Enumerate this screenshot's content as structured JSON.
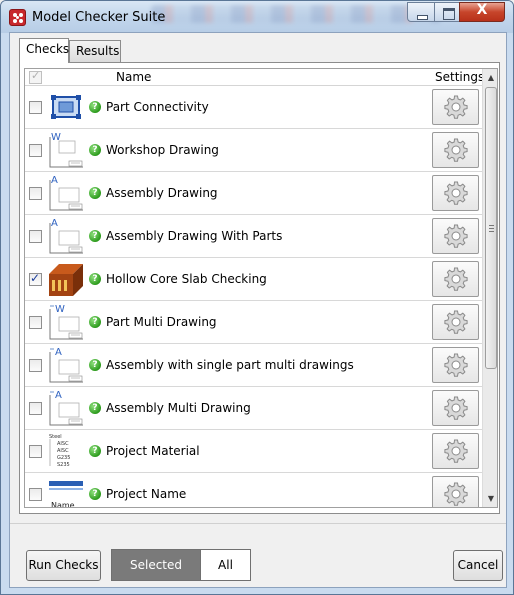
{
  "window": {
    "title": "Model Checker Suite",
    "close_glyph": "X"
  },
  "tabs": [
    {
      "label": "Checks"
    },
    {
      "label": "Results"
    }
  ],
  "grid": {
    "columns": {
      "name": "Name",
      "settings": "Settings"
    },
    "rows": [
      {
        "checked": false,
        "icon": "part-connectivity-thumbnail",
        "status": "?",
        "name": "Part Connectivity"
      },
      {
        "checked": false,
        "icon": "workshop-drawing-thumbnail",
        "status": "?",
        "name": "Workshop Drawing",
        "thumb_letter": "W"
      },
      {
        "checked": false,
        "icon": "assembly-drawing-thumbnail",
        "status": "?",
        "name": "Assembly Drawing",
        "thumb_letter": "A"
      },
      {
        "checked": false,
        "icon": "assembly-drawing-parts-thumbnail",
        "status": "?",
        "name": "Assembly Drawing With Parts",
        "thumb_letter": "A"
      },
      {
        "checked": true,
        "icon": "hollow-core-slab-thumbnail",
        "status": "?",
        "name": "Hollow Core Slab Checking"
      },
      {
        "checked": false,
        "icon": "part-multi-drawing-thumbnail",
        "status": "?",
        "name": "Part Multi Drawing",
        "thumb_letter": "W"
      },
      {
        "checked": false,
        "icon": "assembly-single-multi-thumbnail",
        "status": "?",
        "name": "Assembly with single part multi drawings",
        "thumb_letter": "A"
      },
      {
        "checked": false,
        "icon": "assembly-multi-drawing-thumbnail",
        "status": "?",
        "name": "Assembly Multi Drawing",
        "thumb_letter": "A"
      },
      {
        "checked": false,
        "icon": "project-material-thumbnail",
        "status": "?",
        "name": "Project Material",
        "thumb_lines": [
          "Steel",
          "AISC",
          "AISC",
          "G235",
          "S235"
        ]
      },
      {
        "checked": false,
        "icon": "project-name-thumbnail",
        "status": "?",
        "name": "Project Name",
        "thumb_text": "Name"
      }
    ]
  },
  "buttons": {
    "run": "Run Checks",
    "selected": "Selected",
    "all": "All",
    "cancel": "Cancel"
  },
  "colors": {
    "status_green": "#2d9b1d",
    "selected_segment": "#7a7a7a",
    "close_red": "#c7452b"
  }
}
